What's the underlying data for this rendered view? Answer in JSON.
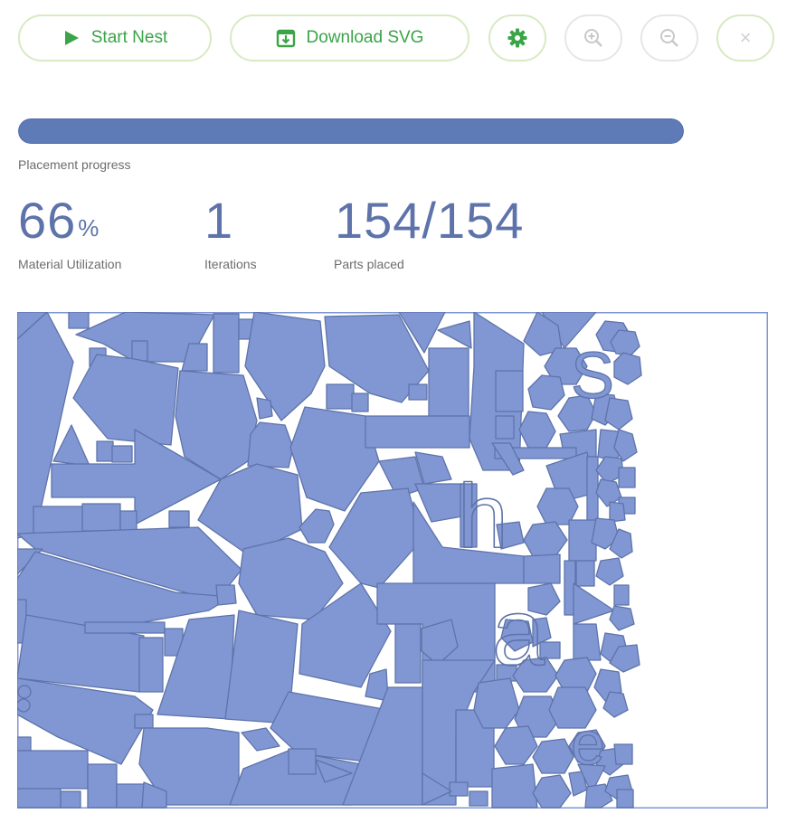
{
  "toolbar": {
    "start_label": "Start Nest",
    "download_label": "Download SVG",
    "icons": {
      "start": "play-icon",
      "download": "download-icon",
      "settings": "gear-icon",
      "zoom_in": "zoom-in-icon",
      "zoom_out": "zoom-out-icon",
      "close": "close-icon"
    },
    "close_glyph": "×"
  },
  "progress": {
    "label": "Placement progress",
    "fraction": 1.0
  },
  "stats": {
    "utilization_value": "66",
    "utilization_unit": "%",
    "utilization_label": "Material Utilization",
    "iterations_value": "1",
    "iterations_label": "Iterations",
    "parts_value": "154/154",
    "parts_label": "Parts placed"
  },
  "colors": {
    "accent_green": "#3aa447",
    "button_border": "#d7eac3",
    "part_fill": "#8197d3",
    "part_stroke": "#5e73aa",
    "progress_fill": "#5e7ab7",
    "stat_text": "#5e73aa"
  },
  "sheet": {
    "glyphs": [
      "S",
      "h",
      "a",
      "e"
    ]
  }
}
